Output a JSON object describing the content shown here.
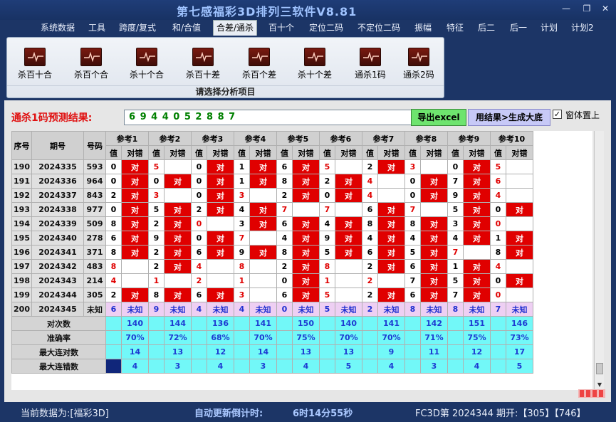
{
  "window": {
    "title": "第七感福彩3D排列三软件V8.81",
    "minimize": "—",
    "restore": "❐",
    "close": "✕"
  },
  "menu": [
    "系统数据",
    "工具",
    "跨度/复式",
    "和/合值",
    "合差/通杀",
    "百十个",
    "定位二码",
    "不定位二码",
    "振幅",
    "特征",
    "后二",
    "后一",
    "计划",
    "计划2"
  ],
  "menu_active": 4,
  "ribbon": {
    "buttons": [
      "杀百十合",
      "杀百个合",
      "杀十个合",
      "杀百十差",
      "杀百个差",
      "杀十个差",
      "通杀1码",
      "通杀2码"
    ],
    "caption": "请选择分析项目",
    "icon": "chart-ekg-icon"
  },
  "prediction": {
    "label": "通杀1码预测结果:",
    "value": "6 9 4 4 0 5 2 8 8 7",
    "export_btn": "导出excel",
    "gen_btn": "用结果>生成大底",
    "pin_label": "窗体置上",
    "pin_checked": "✓"
  },
  "table": {
    "headers": {
      "seq": "序号",
      "period": "期号",
      "number": "号码",
      "val": "值",
      "err": "对错"
    },
    "refs": [
      "参考1",
      "参考2",
      "参考3",
      "参考4",
      "参考5",
      "参考6",
      "参考7",
      "参考8",
      "参考9",
      "参考10"
    ],
    "rows": [
      {
        "seq": "190",
        "period": "2024335",
        "num": "593",
        "vals": [
          "0",
          "5",
          "0",
          "1",
          "6",
          "5",
          "2",
          "3",
          "0",
          "5"
        ],
        "hits": [
          1,
          0,
          1,
          1,
          1,
          0,
          1,
          0,
          1,
          0
        ],
        "red": [
          0,
          1,
          0,
          0,
          0,
          1,
          0,
          1,
          0,
          1
        ]
      },
      {
        "seq": "191",
        "period": "2024336",
        "num": "964",
        "vals": [
          "0",
          "0",
          "0",
          "1",
          "8",
          "2",
          "4",
          "0",
          "7",
          "6"
        ],
        "hits": [
          1,
          1,
          1,
          1,
          1,
          1,
          0,
          1,
          1,
          0
        ],
        "red": [
          0,
          0,
          0,
          0,
          0,
          0,
          1,
          0,
          0,
          1
        ]
      },
      {
        "seq": "192",
        "period": "2024337",
        "num": "843",
        "vals": [
          "2",
          "3",
          "0",
          "3",
          "2",
          "0",
          "4",
          "0",
          "9",
          "4"
        ],
        "hits": [
          1,
          0,
          1,
          0,
          1,
          1,
          0,
          1,
          1,
          0
        ],
        "red": [
          0,
          1,
          0,
          1,
          0,
          0,
          1,
          0,
          0,
          1
        ]
      },
      {
        "seq": "193",
        "period": "2024338",
        "num": "977",
        "vals": [
          "0",
          "5",
          "2",
          "4",
          "7",
          "7",
          "6",
          "7",
          "5",
          "0"
        ],
        "hits": [
          1,
          1,
          1,
          1,
          0,
          0,
          1,
          0,
          1,
          1
        ],
        "red": [
          0,
          0,
          0,
          0,
          1,
          1,
          0,
          1,
          0,
          0
        ]
      },
      {
        "seq": "194",
        "period": "2024339",
        "num": "509",
        "vals": [
          "8",
          "2",
          "0",
          "3",
          "6",
          "4",
          "8",
          "8",
          "3",
          "0"
        ],
        "hits": [
          1,
          1,
          0,
          1,
          1,
          1,
          1,
          1,
          1,
          0
        ],
        "red": [
          0,
          0,
          1,
          0,
          0,
          0,
          0,
          0,
          0,
          1
        ]
      },
      {
        "seq": "195",
        "period": "2024340",
        "num": "278",
        "vals": [
          "6",
          "9",
          "0",
          "7",
          "4",
          "9",
          "4",
          "4",
          "4",
          "1"
        ],
        "hits": [
          1,
          1,
          1,
          0,
          1,
          1,
          1,
          1,
          1,
          1
        ],
        "red": [
          0,
          0,
          0,
          1,
          0,
          0,
          0,
          0,
          0,
          0
        ]
      },
      {
        "seq": "196",
        "period": "2024341",
        "num": "371",
        "vals": [
          "8",
          "2",
          "6",
          "9",
          "8",
          "5",
          "6",
          "5",
          "7",
          "8"
        ],
        "hits": [
          1,
          1,
          1,
          1,
          1,
          1,
          1,
          1,
          0,
          1
        ],
        "red": [
          0,
          0,
          0,
          0,
          0,
          0,
          0,
          0,
          1,
          0
        ]
      },
      {
        "seq": "197",
        "period": "2024342",
        "num": "483",
        "vals": [
          "8",
          "2",
          "4",
          "8",
          "2",
          "8",
          "2",
          "6",
          "1",
          "4"
        ],
        "hits": [
          0,
          1,
          0,
          0,
          1,
          0,
          1,
          1,
          1,
          0
        ],
        "red": [
          1,
          0,
          1,
          1,
          0,
          1,
          0,
          0,
          0,
          1
        ]
      },
      {
        "seq": "198",
        "period": "2024343",
        "num": "214",
        "vals": [
          "4",
          "1",
          "2",
          "1",
          "0",
          "1",
          "2",
          "7",
          "5",
          "0"
        ],
        "hits": [
          0,
          0,
          0,
          0,
          1,
          0,
          0,
          1,
          1,
          1
        ],
        "red": [
          1,
          1,
          1,
          1,
          0,
          1,
          1,
          0,
          0,
          0
        ]
      },
      {
        "seq": "199",
        "period": "2024344",
        "num": "305",
        "vals": [
          "2",
          "8",
          "6",
          "3",
          "6",
          "5",
          "2",
          "6",
          "7",
          "0"
        ],
        "hits": [
          1,
          1,
          1,
          0,
          1,
          0,
          1,
          1,
          1,
          0
        ],
        "red": [
          0,
          0,
          0,
          1,
          0,
          1,
          0,
          0,
          0,
          1
        ]
      }
    ],
    "pending": {
      "seq": "200",
      "period": "2024345",
      "num": "未知",
      "vals": [
        "6",
        "9",
        "4",
        "4",
        "0",
        "5",
        "2",
        "8",
        "8",
        "7"
      ],
      "err": "未知"
    },
    "hit_text": "对",
    "stats": [
      {
        "label": "对次数",
        "vals": [
          "140",
          "144",
          "136",
          "141",
          "150",
          "140",
          "141",
          "142",
          "151",
          "146"
        ]
      },
      {
        "label": "准确率",
        "vals": [
          "70%",
          "72%",
          "68%",
          "70%",
          "75%",
          "70%",
          "70%",
          "71%",
          "75%",
          "73%"
        ]
      },
      {
        "label": "最大连对数",
        "vals": [
          "14",
          "13",
          "12",
          "14",
          "13",
          "13",
          "9",
          "11",
          "12",
          "17"
        ]
      },
      {
        "label": "最大连错数",
        "vals": [
          "4",
          "3",
          "4",
          "3",
          "4",
          "5",
          "4",
          "3",
          "4",
          "5"
        ]
      }
    ]
  },
  "status": {
    "current": "当前数据为:[福彩3D]",
    "countdown_label": "自动更新倒计时:",
    "countdown": "6时14分55秒",
    "draw": "FC3D第 2024344 期开:【305】【746】"
  },
  "colors": {
    "hit": "#e00000",
    "pending": "#eecff3",
    "stats": "#72f8f8",
    "stats_text": "#1d3bd2",
    "titlebar": "#1c3566"
  }
}
